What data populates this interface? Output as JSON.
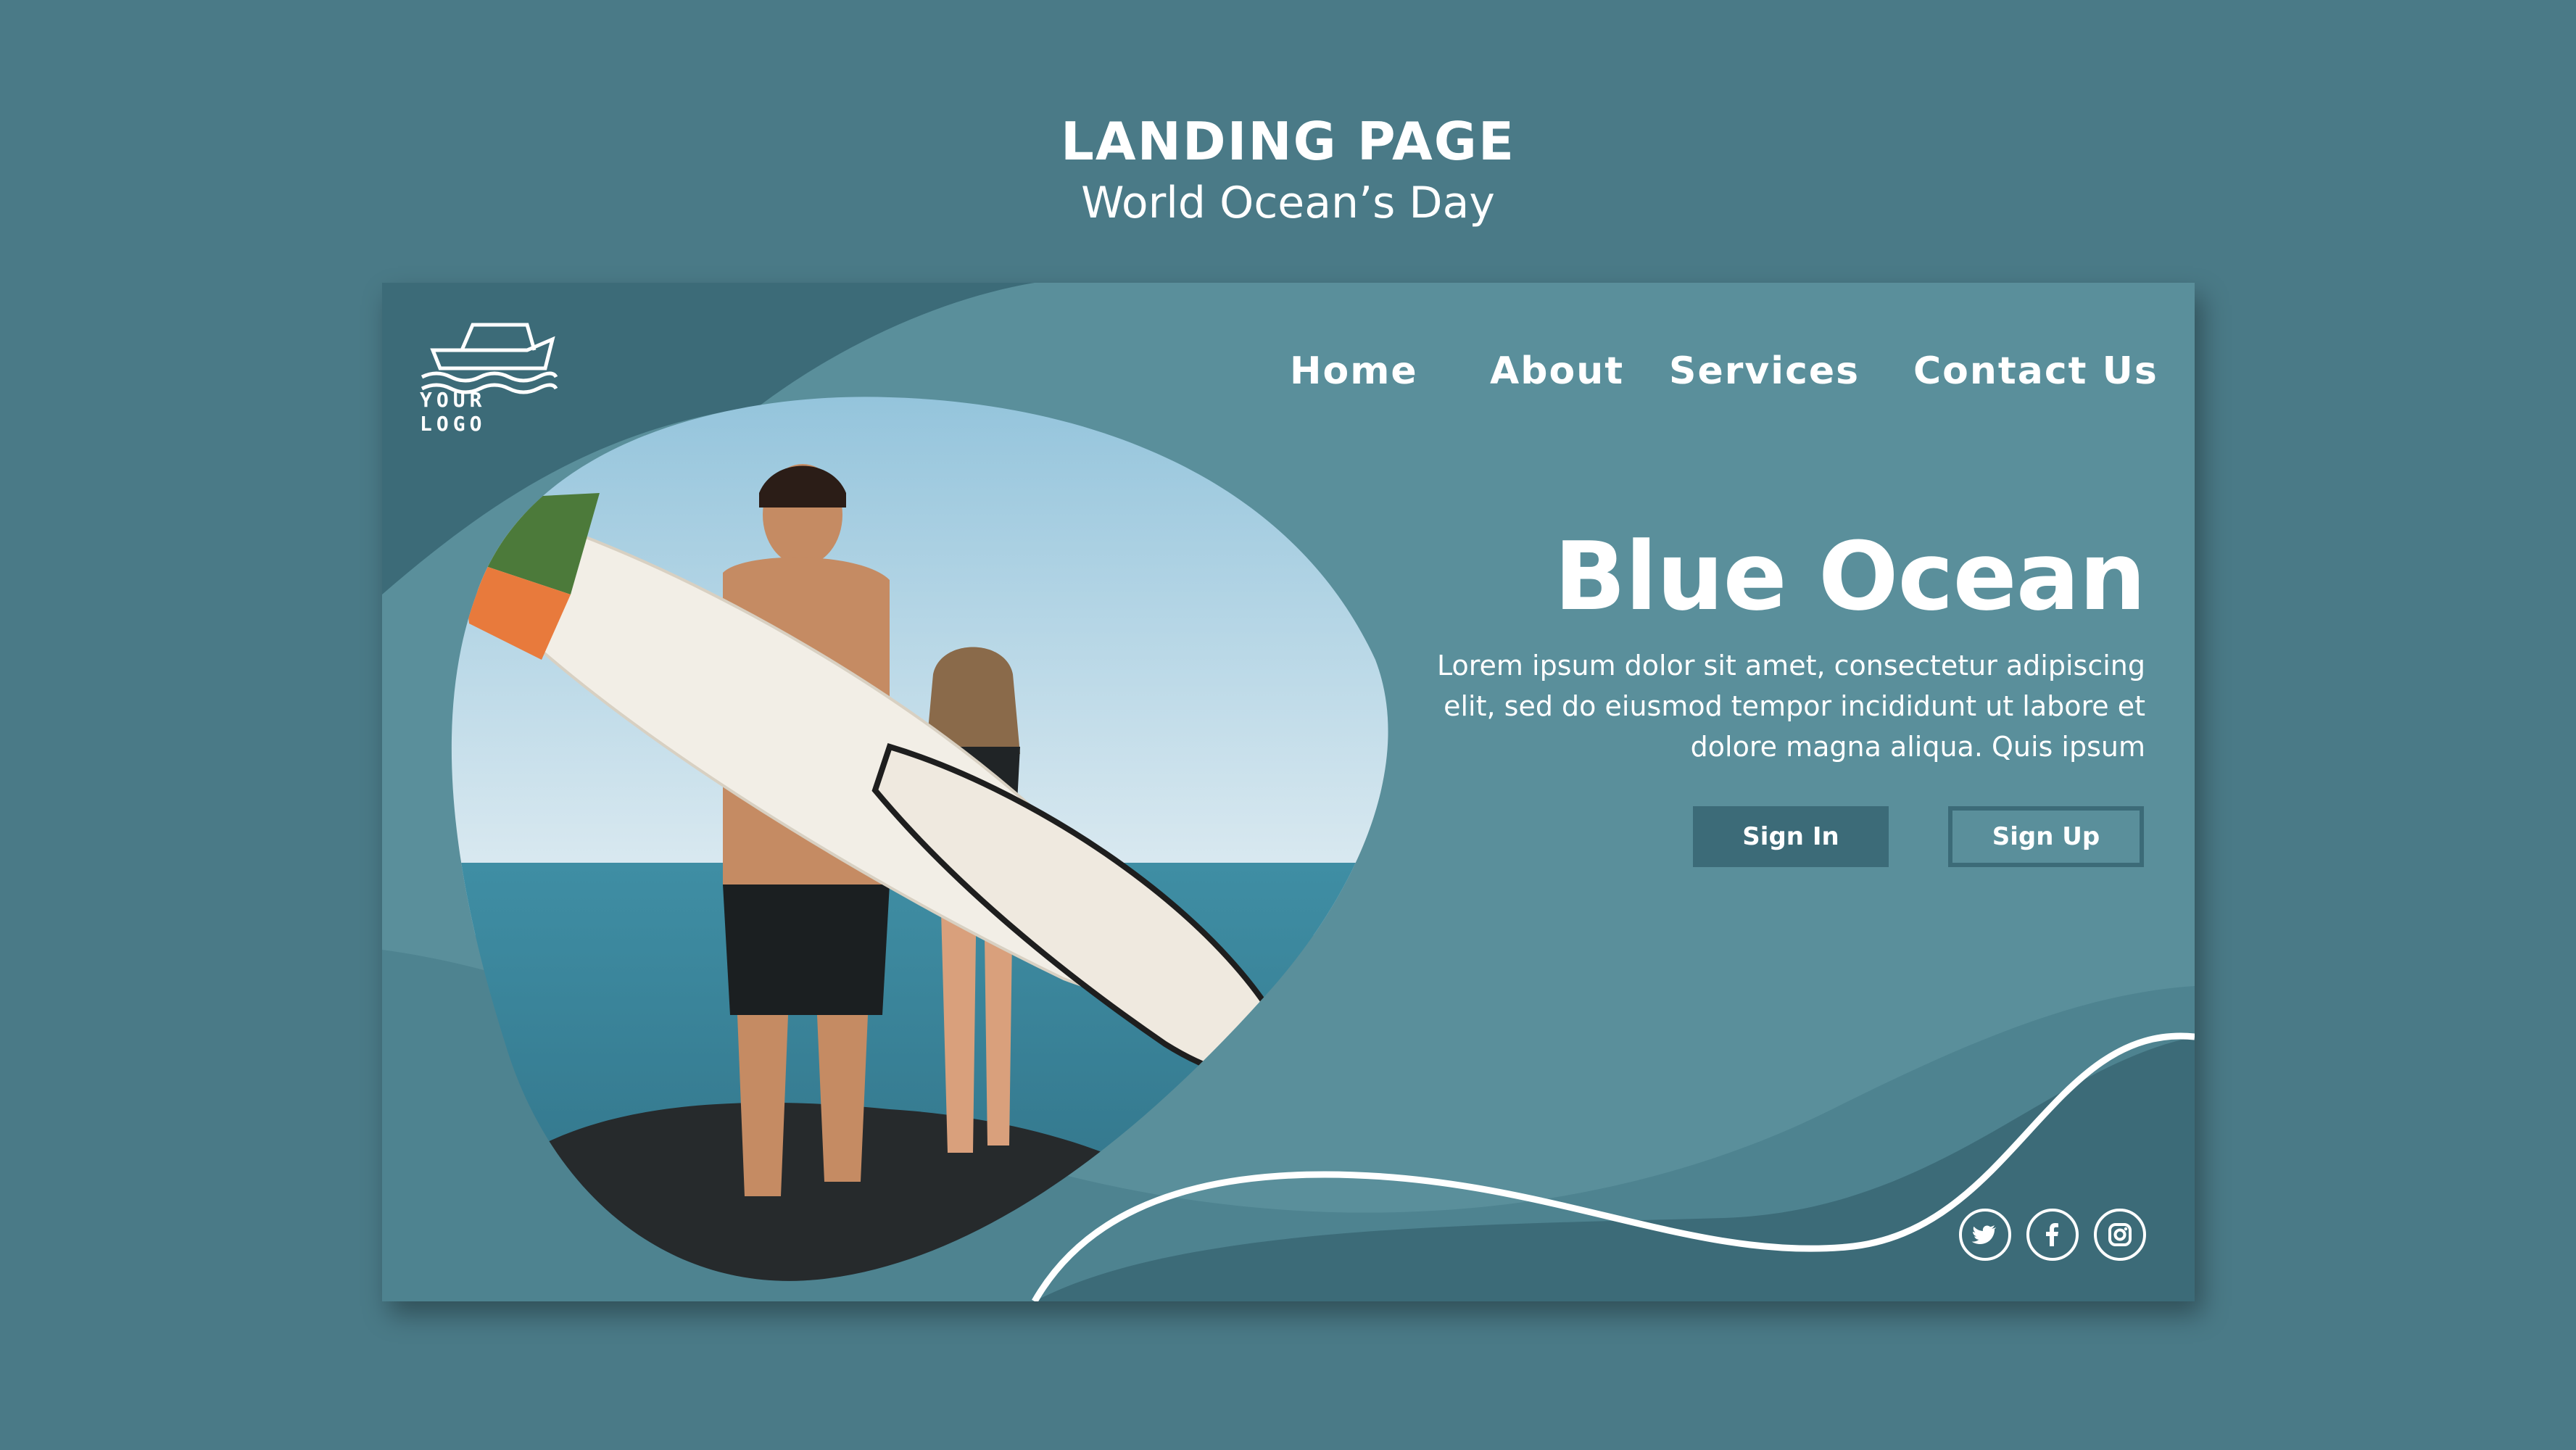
{
  "heading": {
    "title": "LANDING PAGE",
    "subtitle": "World Ocean’s Day"
  },
  "logo": {
    "text": "YOUR LOGO",
    "icon": "boat-on-waves-icon"
  },
  "nav": {
    "items": [
      {
        "label": "Home"
      },
      {
        "label": "About"
      },
      {
        "label": "Services"
      },
      {
        "label": "Contact Us"
      }
    ]
  },
  "hero": {
    "title": "Blue Ocean",
    "body": "Lorem ipsum dolor sit amet, consectetur adipiscing elit, sed do eiusmod tempor incididunt ut labore et dolore magna aliqua. Quis ipsum",
    "signin_label": "Sign In",
    "signup_label": "Sign Up"
  },
  "photo": {
    "description_icon": "surfers-photo"
  },
  "social": {
    "icons": [
      "twitter-icon",
      "facebook-icon",
      "instagram-icon"
    ]
  },
  "colors": {
    "background": "#4a7a87",
    "panel": "#5a8f9b",
    "panel_dark": "#3c6b78",
    "text": "#ffffff"
  }
}
